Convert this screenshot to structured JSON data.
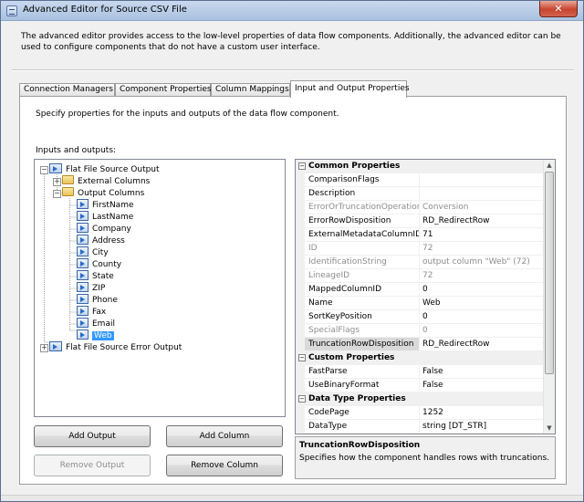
{
  "window": {
    "title": "Advanced Editor for Source CSV File",
    "close_glyph": "✕"
  },
  "description": "The advanced editor provides access to the low-level properties of data flow components. Additionally, the advanced editor can be used to configure components that do not have a custom user interface.",
  "tabs": [
    {
      "label": "Connection Managers",
      "active": false
    },
    {
      "label": "Component Properties",
      "active": false
    },
    {
      "label": "Column Mappings",
      "active": false
    },
    {
      "label": "Input and Output Properties",
      "active": true
    }
  ],
  "panel": {
    "description": "Specify properties for the inputs and outputs of the data flow component.",
    "io_label": "Inputs and outputs:"
  },
  "tree": {
    "root_output": "Flat File Source Output",
    "external_columns": "External Columns",
    "output_columns": "Output Columns",
    "columns": [
      "FirstName",
      "LastName",
      "Company",
      "Address",
      "City",
      "County",
      "State",
      "ZIP",
      "Phone",
      "Fax",
      "Email",
      "Web"
    ],
    "selected_column": "Web",
    "error_output": "Flat File Source Error Output",
    "expand_glyph": "+",
    "collapse_glyph": "−"
  },
  "buttons": {
    "add_output": "Add Output",
    "add_column": "Add Column",
    "remove_output": "Remove Output",
    "remove_column": "Remove Column"
  },
  "properties": {
    "common": {
      "label": "Common Properties",
      "rows": [
        {
          "name": "ComparisonFlags",
          "value": "",
          "readonly": false
        },
        {
          "name": "Description",
          "value": "",
          "readonly": false
        },
        {
          "name": "ErrorOrTruncationOperation",
          "value": "Conversion",
          "readonly": true
        },
        {
          "name": "ErrorRowDisposition",
          "value": "RD_RedirectRow",
          "readonly": false
        },
        {
          "name": "ExternalMetadataColumnID",
          "value": "71",
          "readonly": false
        },
        {
          "name": "ID",
          "value": "72",
          "readonly": true
        },
        {
          "name": "IdentificationString",
          "value": "output column \"Web\" (72)",
          "readonly": true
        },
        {
          "name": "LineageID",
          "value": "72",
          "readonly": true
        },
        {
          "name": "MappedColumnID",
          "value": "0",
          "readonly": false
        },
        {
          "name": "Name",
          "value": "Web",
          "readonly": false
        },
        {
          "name": "SortKeyPosition",
          "value": "0",
          "readonly": false
        },
        {
          "name": "SpecialFlags",
          "value": "0",
          "readonly": true
        },
        {
          "name": "TruncationRowDisposition",
          "value": "RD_RedirectRow",
          "readonly": false
        }
      ]
    },
    "custom": {
      "label": "Custom Properties",
      "rows": [
        {
          "name": "FastParse",
          "value": "False",
          "readonly": false
        },
        {
          "name": "UseBinaryFormat",
          "value": "False",
          "readonly": false
        }
      ]
    },
    "datatype": {
      "label": "Data Type Properties",
      "rows": [
        {
          "name": "CodePage",
          "value": "1252",
          "readonly": false
        },
        {
          "name": "DataType",
          "value": "string [DT_STR]",
          "readonly": false
        }
      ]
    },
    "selected_property": "TruncationRowDisposition",
    "collapse_glyph": "−"
  },
  "help": {
    "title": "TruncationRowDisposition",
    "text": "Specifies how the component handles rows with truncations."
  },
  "scroll": {
    "up_glyph": "▲",
    "down_glyph": "▼"
  }
}
